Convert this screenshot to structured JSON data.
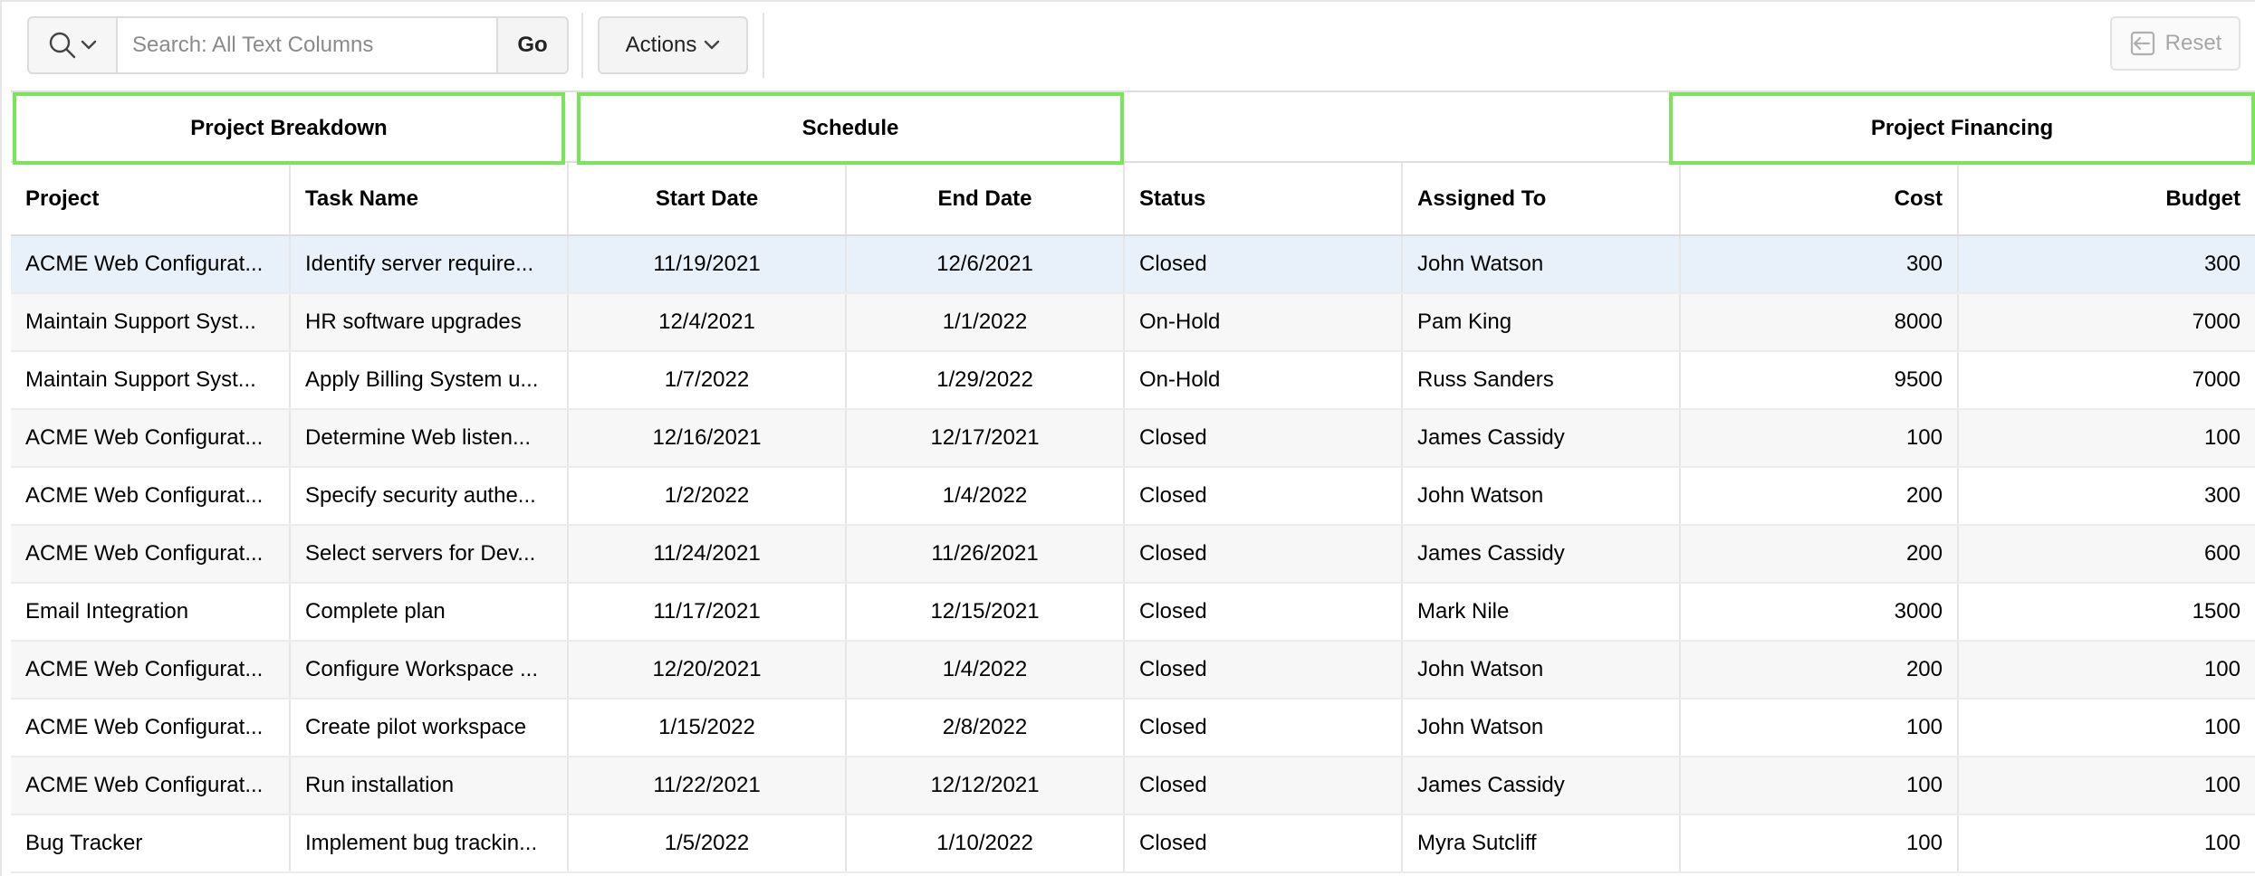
{
  "toolbar": {
    "search_placeholder": "Search: All Text Columns",
    "go_label": "Go",
    "actions_label": "Actions",
    "reset_label": "Reset"
  },
  "column_groups": {
    "project_breakdown": "Project Breakdown",
    "schedule": "Schedule",
    "project_financing": "Project Financing"
  },
  "columns": [
    "Project",
    "Task Name",
    "Start Date",
    "End Date",
    "Status",
    "Assigned To",
    "Cost",
    "Budget"
  ],
  "rows": [
    [
      "ACME Web Configurat...",
      "Identify server require...",
      "11/19/2021",
      "12/6/2021",
      "Closed",
      "John Watson",
      "300",
      "300"
    ],
    [
      "Maintain Support Syst...",
      "HR software upgrades",
      "12/4/2021",
      "1/1/2022",
      "On-Hold",
      "Pam King",
      "8000",
      "7000"
    ],
    [
      "Maintain Support Syst...",
      "Apply Billing System u...",
      "1/7/2022",
      "1/29/2022",
      "On-Hold",
      "Russ Sanders",
      "9500",
      "7000"
    ],
    [
      "ACME Web Configurat...",
      "Determine Web listen...",
      "12/16/2021",
      "12/17/2021",
      "Closed",
      "James Cassidy",
      "100",
      "100"
    ],
    [
      "ACME Web Configurat...",
      "Specify security authe...",
      "1/2/2022",
      "1/4/2022",
      "Closed",
      "John Watson",
      "200",
      "300"
    ],
    [
      "ACME Web Configurat...",
      "Select servers for Dev...",
      "11/24/2021",
      "11/26/2021",
      "Closed",
      "James Cassidy",
      "200",
      "600"
    ],
    [
      "Email Integration",
      "Complete plan",
      "11/17/2021",
      "12/15/2021",
      "Closed",
      "Mark Nile",
      "3000",
      "1500"
    ],
    [
      "ACME Web Configurat...",
      "Configure Workspace ...",
      "12/20/2021",
      "1/4/2022",
      "Closed",
      "John Watson",
      "200",
      "100"
    ],
    [
      "ACME Web Configurat...",
      "Create pilot workspace",
      "1/15/2022",
      "2/8/2022",
      "Closed",
      "John Watson",
      "100",
      "100"
    ],
    [
      "ACME Web Configurat...",
      "Run installation",
      "11/22/2021",
      "12/12/2021",
      "Closed",
      "James Cassidy",
      "100",
      "100"
    ],
    [
      "Bug Tracker",
      "Implement bug trackin...",
      "1/5/2022",
      "1/10/2022",
      "Closed",
      "Myra Sutcliff",
      "100",
      "100"
    ]
  ],
  "colors": {
    "highlight_border": "#79e65a",
    "selected_row": "#e8f0fa"
  }
}
